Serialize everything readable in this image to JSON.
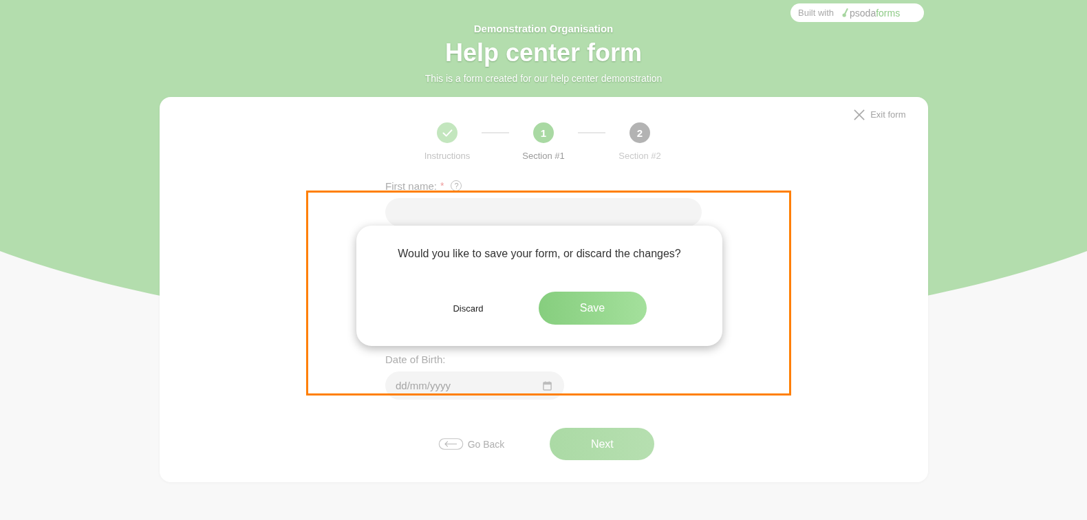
{
  "badge": {
    "label": "Built with",
    "logo_name": "psoda",
    "logo_suffix": "forms"
  },
  "header": {
    "organisation": "Demonstration Organisation",
    "title": "Help center form",
    "subtitle": "This is a form created for our help center demonstration"
  },
  "exit_link": {
    "label": "Exit form"
  },
  "steps": [
    {
      "label": "Instructions",
      "completed": true,
      "selected": false
    },
    {
      "label": "Section #1",
      "number": "1",
      "completed": false,
      "selected": true
    },
    {
      "label": "Section #2",
      "number": "2",
      "completed": false,
      "selected": false
    }
  ],
  "fields": [
    {
      "label": "First name:",
      "kind": "text",
      "required_mark": "*",
      "help": "?"
    },
    {
      "label": "Date of Birth:",
      "kind": "date",
      "placeholder": "dd/mm/yyyy"
    }
  ],
  "navigation": {
    "back": "Go Back",
    "next": "Next"
  },
  "dialog": {
    "message": "Would you like to save your form, or discard the changes?",
    "buttons": [
      {
        "label": "Discard",
        "kind": "secondary"
      },
      {
        "label": "Save",
        "kind": "primary"
      }
    ]
  },
  "highlight_frame": true
}
